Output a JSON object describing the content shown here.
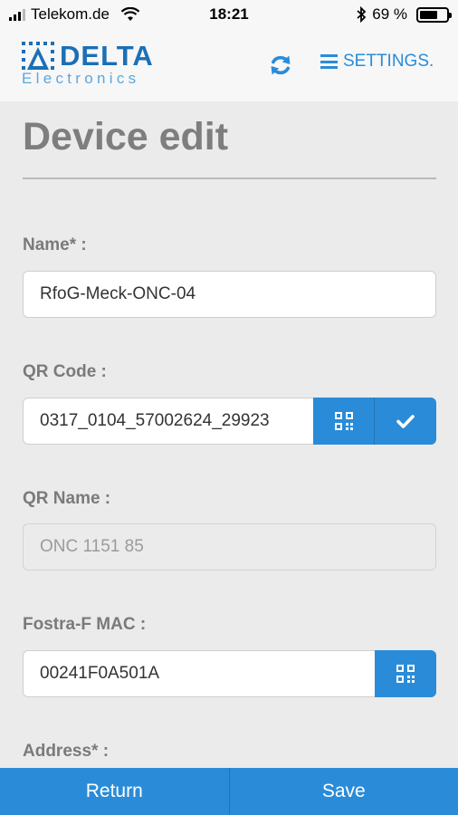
{
  "status_bar": {
    "carrier": "Telekom.de",
    "time": "18:21",
    "battery_percent": "69 %",
    "battery_level": 0.69
  },
  "header": {
    "logo_word": "DELTA",
    "logo_sub": "Electronics",
    "settings_label": "SETTINGS."
  },
  "page": {
    "title": "Device edit"
  },
  "form": {
    "name_label": "Name* :",
    "name_value": "RfoG-Meck-ONC-04",
    "qr_code_label": "QR Code :",
    "qr_code_value": "0317_0104_57002624_29923",
    "qr_name_label": "QR Name :",
    "qr_name_value": "ONC 1151 85",
    "mac_label": "Fostra-F MAC :",
    "mac_value": "00241F0A501A",
    "address_label": "Address* :"
  },
  "footer": {
    "return_label": "Return",
    "save_label": "Save"
  },
  "colors": {
    "accent": "#2a8cd8",
    "brand": "#1b6fb6",
    "label": "#7a7a7a"
  }
}
